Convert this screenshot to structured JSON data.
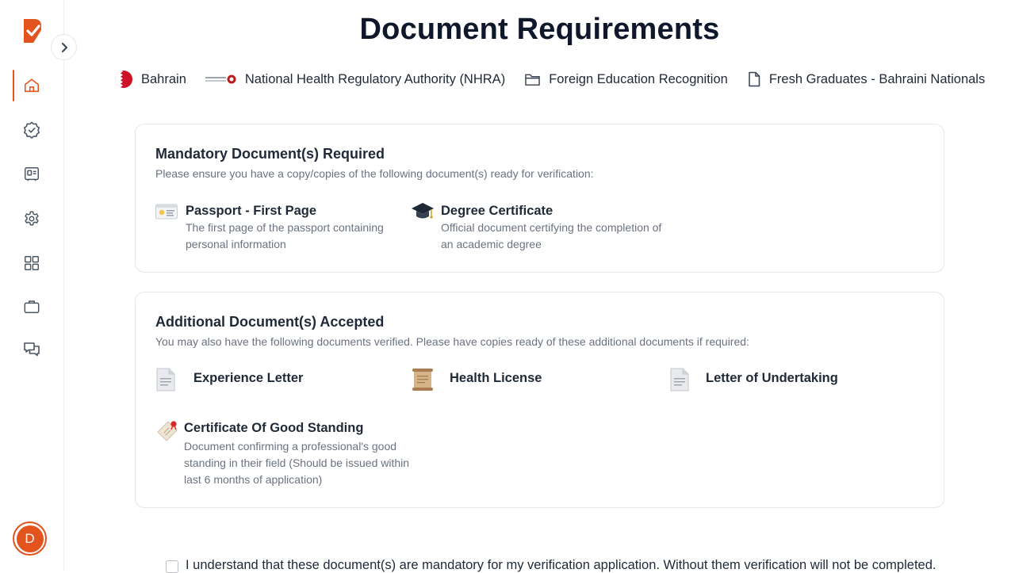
{
  "page": {
    "title": "Document Requirements"
  },
  "sidebar": {
    "avatar_initial": "D",
    "accent_color": "#e2531e",
    "items": [
      {
        "icon": "home-icon",
        "active": true
      },
      {
        "icon": "verified-badge-icon",
        "active": false
      },
      {
        "icon": "id-card-icon",
        "active": false
      },
      {
        "icon": "gear-icon",
        "active": false
      },
      {
        "icon": "grid-icon",
        "active": false
      },
      {
        "icon": "briefcase-icon",
        "active": false
      },
      {
        "icon": "chat-icon",
        "active": false
      }
    ]
  },
  "breadcrumb": {
    "country": "Bahrain",
    "authority": "National Health Regulatory Authority (NHRA)",
    "service": "Foreign Education Recognition",
    "category": "Fresh Graduates - Bahraini Nationals"
  },
  "mandatory": {
    "title": "Mandatory Document(s) Required",
    "subtitle": "Please ensure you have a copy/copies of the following document(s) ready for verification:",
    "docs": [
      {
        "name": "Passport - First Page",
        "desc": "The first page of the passport containing personal information",
        "icon": "passport-icon"
      },
      {
        "name": "Degree Certificate",
        "desc": "Official document certifying the completion of an academic degree",
        "icon": "graduation-cap-icon"
      }
    ]
  },
  "additional": {
    "title": "Additional Document(s) Accepted",
    "subtitle": "You may also have the following documents verified. Please have copies ready of these additional documents if required:",
    "docs": [
      {
        "name": "Experience Letter",
        "icon": "document-icon"
      },
      {
        "name": "Health License",
        "icon": "scroll-icon"
      },
      {
        "name": "Letter of Undertaking",
        "icon": "document-icon"
      },
      {
        "name": "Certificate Of Good Standing",
        "desc": "Document confirming a professional's good standing in their field (Should be issued within last 6 months of application)",
        "icon": "stamped-certificate-icon"
      }
    ]
  },
  "consent": {
    "text": "I understand that these document(s) are mandatory for my verification application. Without them verification will not be completed.",
    "checked": false
  }
}
